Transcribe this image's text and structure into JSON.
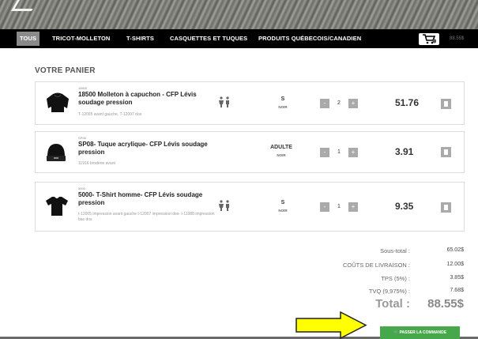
{
  "nav": {
    "items": [
      "TOUS",
      "TRICOT-MOLLETON",
      "T-SHIRTS",
      "CASQUETTES ET TUQUES",
      "PRODUITS QUÉBECOIS/CANADIEN"
    ],
    "cart_total": "88.55$"
  },
  "cart": {
    "title": "VOTRE PANIER",
    "items": [
      {
        "sku": "18500",
        "name": "18500 Molleton à capuchon - CFP Lévis soudage pression",
        "description": "T-12005 avant gauche, T-12007 dos",
        "size": "S",
        "color": "NOIR",
        "quantity": "2",
        "price": "51.76",
        "thumbnail_icon": "hoodie-icon",
        "gender_icon": "unisex-icon"
      },
      {
        "sku": "SP08",
        "name": "SP08- Tuque acrylique- CFP Lévis soudage pression",
        "description": "11916 broderie avant",
        "size": "ADULTE",
        "color": "NOIR",
        "quantity": "1",
        "price": "3.91",
        "thumbnail_icon": "beanie-icon",
        "gender_icon": ""
      },
      {
        "sku": "5000",
        "name": "5000- T-Shirt homme- CFP Lévis soudage pression",
        "description": "t-12005 impression avant gauche t-12007 impression dos- t-11988 impression bas dos",
        "size": "S",
        "color": "NOIR",
        "quantity": "1",
        "price": "9.35",
        "thumbnail_icon": "tshirt-icon",
        "gender_icon": "unisex-icon"
      }
    ],
    "minus_label": "-",
    "plus_label": "+"
  },
  "totals": {
    "subtotal_label": "Sous-total :",
    "subtotal": "65.02$",
    "shipping_label": "COÛTS DE LIVRAISON :",
    "shipping": "12.00$",
    "tps_label": "TPS (5%) :",
    "tps": "3.85$",
    "tvq_label": "TVQ (9,975%) :",
    "tvq": "7.68$",
    "total_label": "Total :",
    "total": "88.55$"
  },
  "checkout_label": "PASSER LA COMMANDE",
  "colors": {
    "nav_bg": "#000000",
    "active_tab": "#8a8a8a",
    "checkout_green": "#47a84b",
    "annotation_arrow": "#ffff00"
  }
}
